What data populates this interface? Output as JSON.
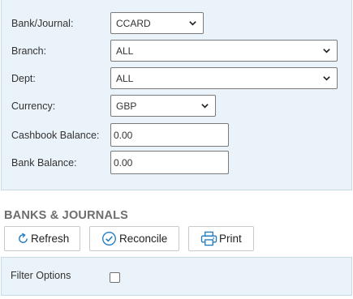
{
  "form": {
    "bank_journal": {
      "label": "Bank/Journal:",
      "value": "CCARD"
    },
    "branch": {
      "label": "Branch:",
      "value": "ALL"
    },
    "dept": {
      "label": "Dept:",
      "value": "ALL"
    },
    "currency": {
      "label": "Currency:",
      "value": "GBP"
    },
    "cashbook_balance": {
      "label": "Cashbook Balance:",
      "value": "0.00"
    },
    "bank_balance": {
      "label": "Bank Balance:",
      "value": "0.00"
    }
  },
  "section": {
    "title": "BANKS & JOURNALS"
  },
  "toolbar": {
    "refresh_label": "Refresh",
    "reconcile_label": "Reconcile",
    "print_label": "Print"
  },
  "options": {
    "filter_label": "Filter Options",
    "filter_checked": false
  },
  "colors": {
    "panel_bg": "#eaf3fa",
    "panel_border": "#c5dbe9",
    "icon_blue": "#1f7bc1",
    "section_title": "#6d6d6d"
  },
  "icons": {
    "refresh": "refresh-icon",
    "reconcile": "check-circle-icon",
    "print": "printer-icon",
    "dropdown": "chevron-down-icon"
  }
}
